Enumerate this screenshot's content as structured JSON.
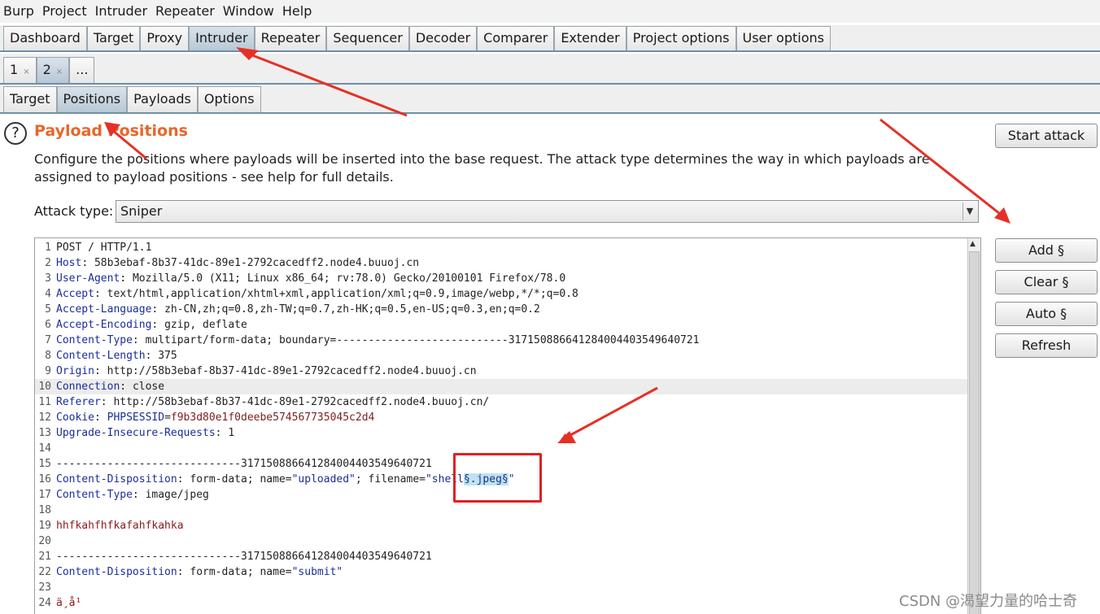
{
  "menu": [
    "Burp",
    "Project",
    "Intruder",
    "Repeater",
    "Window",
    "Help"
  ],
  "main_tabs": [
    {
      "label": "Dashboard"
    },
    {
      "label": "Target"
    },
    {
      "label": "Proxy"
    },
    {
      "label": "Intruder",
      "selected": true
    },
    {
      "label": "Repeater"
    },
    {
      "label": "Sequencer"
    },
    {
      "label": "Decoder"
    },
    {
      "label": "Comparer"
    },
    {
      "label": "Extender"
    },
    {
      "label": "Project options"
    },
    {
      "label": "User options"
    }
  ],
  "request_tabs": [
    {
      "label": "1",
      "close": "×"
    },
    {
      "label": "2",
      "close": "×",
      "selected": true
    },
    {
      "label": "..."
    }
  ],
  "sub_tabs": [
    {
      "label": "Target"
    },
    {
      "label": "Positions",
      "selected": true
    },
    {
      "label": "Payloads"
    },
    {
      "label": "Options"
    }
  ],
  "panel": {
    "help_glyph": "?",
    "title": "Payload Positions",
    "description": "Configure the positions where payloads will be inserted into the base request. The attack type determines the way in which payloads are assigned to payload positions - see help for full details.",
    "start_attack": "Start attack",
    "attack_type_label": "Attack type:",
    "attack_type_value": "Sniper",
    "side_buttons": [
      "Add §",
      "Clear §",
      "Auto §",
      "Refresh"
    ]
  },
  "request_lines": [
    {
      "n": "1",
      "text": "POST / HTTP/1.1"
    },
    {
      "n": "2",
      "key": "Host",
      "value": "58b3ebaf-8b37-41dc-89e1-2792cacedff2.node4.buuoj.cn"
    },
    {
      "n": "3",
      "key": "User-Agent",
      "value": "Mozilla/5.0 (X11; Linux x86_64; rv:78.0) Gecko/20100101 Firefox/78.0"
    },
    {
      "n": "4",
      "key": "Accept",
      "value": "text/html,application/xhtml+xml,application/xml;q=0.9,image/webp,*/*;q=0.8"
    },
    {
      "n": "5",
      "key": "Accept-Language",
      "value": "zh-CN,zh;q=0.8,zh-TW;q=0.7,zh-HK;q=0.5,en-US;q=0.3,en;q=0.2"
    },
    {
      "n": "6",
      "key": "Accept-Encoding",
      "value": "gzip, deflate"
    },
    {
      "n": "7",
      "key": "Content-Type",
      "value": "multipart/form-data; boundary=---------------------------317150886641284004403549640721"
    },
    {
      "n": "8",
      "key": "Content-Length",
      "value": "375"
    },
    {
      "n": "9",
      "key": "Origin",
      "value": "http://58b3ebaf-8b37-41dc-89e1-2792cacedff2.node4.buuoj.cn"
    },
    {
      "n": "10",
      "key": "Connection",
      "value": "close",
      "highlight": true
    },
    {
      "n": "11",
      "key": "Referer",
      "value": "http://58b3ebaf-8b37-41dc-89e1-2792cacedff2.node4.buuoj.cn/"
    },
    {
      "n": "12",
      "key": "Cookie",
      "cookie_name": "PHPSESSID",
      "cookie_value": "f9b3d80e1f0deebe574567735045c2d4"
    },
    {
      "n": "13",
      "key": "Upgrade-Insecure-Requests",
      "value": "1"
    },
    {
      "n": "14",
      "text": ""
    },
    {
      "n": "15",
      "text": "-----------------------------317150886641284004403549640721"
    },
    {
      "n": "16",
      "key": "Content-Disposition",
      "cd_prefix": "form-data; name=",
      "cd_name": "\"uploaded\"",
      "cd_mid": "; filename=",
      "cd_file_pre": "\"shell",
      "cd_marker": "§.jpeg§",
      "cd_file_post": "\""
    },
    {
      "n": "17",
      "key": "Content-Type",
      "value": "image/jpeg"
    },
    {
      "n": "18",
      "text": ""
    },
    {
      "n": "19",
      "body": "hhfkahfhfkafahfkahka"
    },
    {
      "n": "20",
      "text": ""
    },
    {
      "n": "21",
      "text": "-----------------------------317150886641284004403549640721"
    },
    {
      "n": "22",
      "key": "Content-Disposition",
      "cd_prefix": "form-data; name=",
      "cd_name": "\"submit\""
    },
    {
      "n": "23",
      "text": ""
    },
    {
      "n": "24",
      "body": "ä¸å¹"
    }
  ],
  "watermark": "CSDN @渴望力量的哈士奇"
}
